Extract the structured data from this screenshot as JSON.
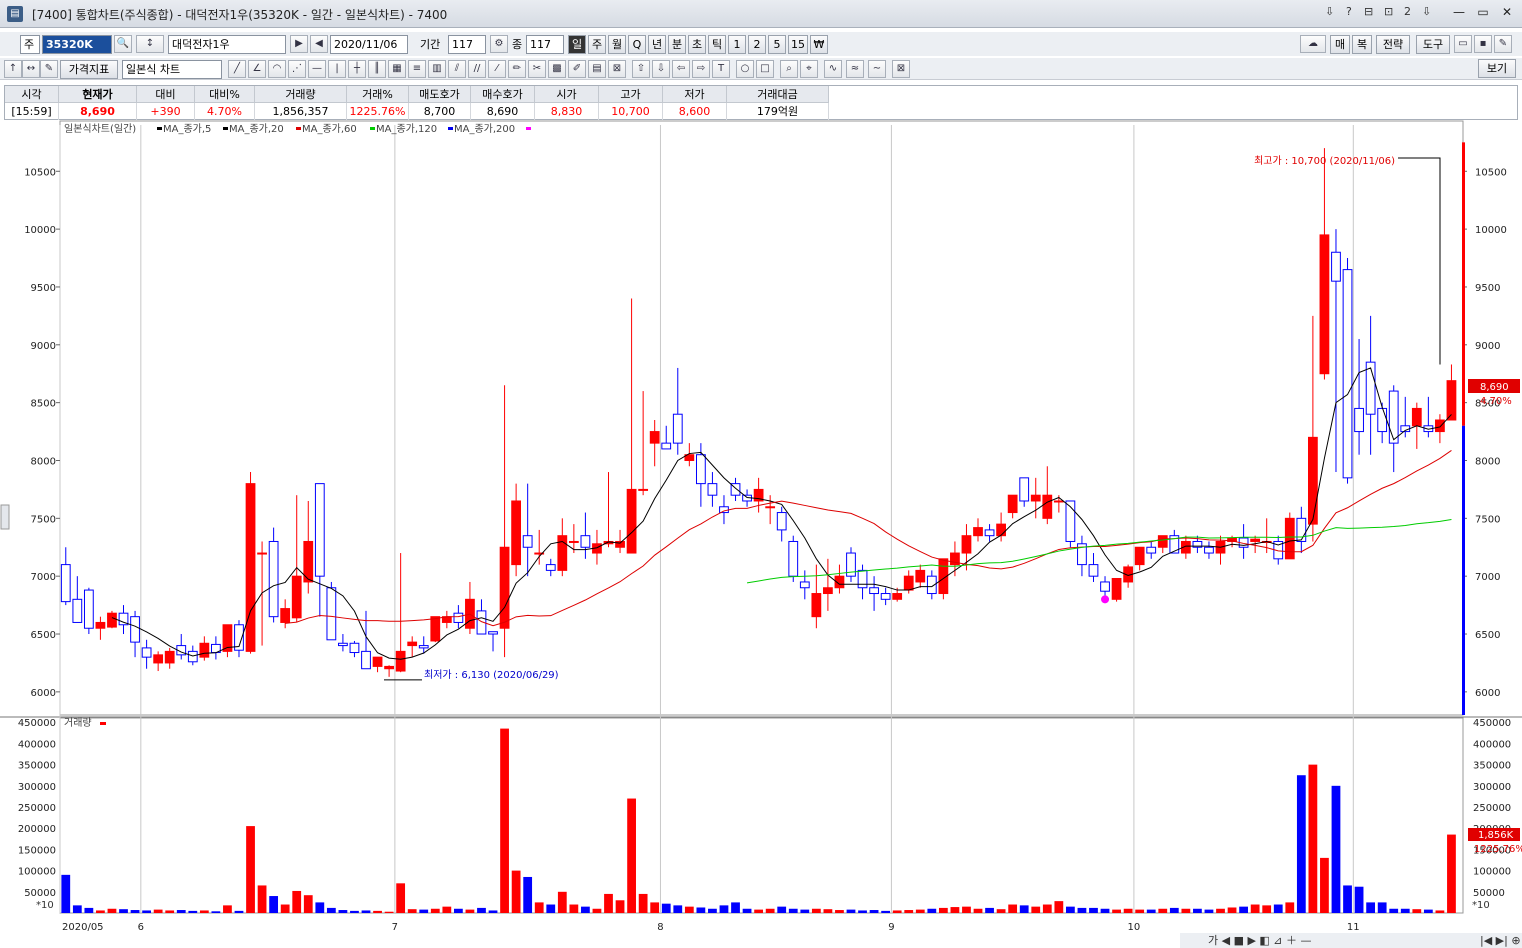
{
  "window": {
    "title": "[7400] 통합차트(주식종합) - 대덕전자1우(35320K - 일간 - 일본식차트) - 7400",
    "controls": [
      "⇩",
      "?",
      "⊟",
      "⊡",
      "2",
      "⇩",
      "—",
      "▭",
      "✕"
    ]
  },
  "toolbar1": {
    "type_label": "주",
    "code": "35320K",
    "stock_name": "대덕전자1우",
    "date": "2020/11/06",
    "period_label": "기간",
    "period_value": "117",
    "count_label": "종",
    "count_value": "117",
    "intervals": [
      "일",
      "주",
      "월",
      "Q",
      "년",
      "분",
      "초",
      "틱",
      "1",
      "2",
      "5",
      "15",
      "₩"
    ],
    "right_buttons": [
      "매",
      "복",
      "전략",
      "도구"
    ]
  },
  "toolbar2": {
    "indicator_btn": "가격지표",
    "chart_type": "일본식 차트",
    "view_btn": "보기"
  },
  "quote": {
    "headers": [
      "시각",
      "현재가",
      "대비",
      "대비%",
      "거래량",
      "거래%",
      "매도호가",
      "매수호가",
      "시가",
      "고가",
      "저가",
      "거래대금"
    ],
    "values": [
      "[15:59]",
      "8,690",
      "+390",
      "4.70%",
      "1,856,357",
      "1225.76%",
      "8,700",
      "8,690",
      "8,830",
      "10,700",
      "8,600",
      "179억원"
    ]
  },
  "colors": {
    "up": "#ff0000",
    "down": "#0000ff",
    "ma5": "#000000",
    "ma20": "#dd0000",
    "ma60": "#00cc00",
    "ma120": "#0000ee",
    "ma200": "#ff00ff"
  },
  "chart_data": {
    "type": "candlestick",
    "legend": {
      "title": "일본식차트(일간)",
      "items": [
        "MA_종가,5",
        "MA_종가,20",
        "MA_종가,60",
        "MA_종가,120",
        "MA_종가,200"
      ]
    },
    "volume_title": "거래량",
    "volume_unit": "*10",
    "price_ylim": [
      5800,
      10900
    ],
    "price_ticks": [
      6000,
      6500,
      7000,
      7500,
      8000,
      8500,
      9000,
      9500,
      10000,
      10500
    ],
    "volume_ylim": [
      0,
      460000
    ],
    "volume_ticks": [
      50000,
      100000,
      150000,
      200000,
      250000,
      300000,
      350000,
      400000,
      450000
    ],
    "x_labels": [
      {
        "i": 0,
        "t": "2020/05"
      },
      {
        "i": 7,
        "t": "6"
      },
      {
        "i": 29,
        "t": "7"
      },
      {
        "i": 52,
        "t": "8"
      },
      {
        "i": 72,
        "t": "9"
      },
      {
        "i": 93,
        "t": "10"
      },
      {
        "i": 112,
        "t": "11"
      }
    ],
    "annotations": {
      "high": {
        "text": "최고가 : 10,700 (2020/11/06)",
        "i": 108,
        "v": 10700
      },
      "low": {
        "text": "최저가 : 6,130 (2020/06/29)",
        "i": 28,
        "v": 6130
      }
    },
    "last_price": {
      "price": "8,690",
      "pct": "4.70%",
      "vol": "1,856K",
      "volpct": "1225.76%"
    },
    "candles": [
      [
        7100,
        7250,
        6750,
        6780,
        90000
      ],
      [
        6800,
        7000,
        6600,
        6600,
        18000
      ],
      [
        6880,
        6900,
        6500,
        6550,
        12000
      ],
      [
        6550,
        6650,
        6450,
        6600,
        6000
      ],
      [
        6560,
        6700,
        6550,
        6680,
        10000
      ],
      [
        6680,
        6750,
        6500,
        6580,
        9000
      ],
      [
        6650,
        6700,
        6300,
        6430,
        7000
      ],
      [
        6380,
        6450,
        6200,
        6300,
        6000
      ],
      [
        6250,
        6350,
        6180,
        6320,
        8000
      ],
      [
        6250,
        6380,
        6200,
        6350,
        6000
      ],
      [
        6400,
        6500,
        6280,
        6320,
        7000
      ],
      [
        6350,
        6400,
        6230,
        6260,
        5000
      ],
      [
        6300,
        6480,
        6270,
        6420,
        6000
      ],
      [
        6410,
        6480,
        6280,
        6340,
        4000
      ],
      [
        6350,
        6550,
        6300,
        6580,
        18000
      ],
      [
        6580,
        6620,
        6300,
        6360,
        5000
      ],
      [
        6350,
        7900,
        6330,
        7800,
        205000
      ],
      [
        7200,
        7300,
        6400,
        7200,
        65000
      ],
      [
        7300,
        7420,
        6600,
        6650,
        40000
      ],
      [
        6600,
        6800,
        6550,
        6720,
        20000
      ],
      [
        6640,
        7700,
        6600,
        7000,
        52000
      ],
      [
        6950,
        7650,
        6850,
        7300,
        42000
      ],
      [
        7800,
        7800,
        6650,
        7000,
        25000
      ],
      [
        6900,
        6950,
        6450,
        6450,
        12000
      ],
      [
        6420,
        6500,
        6350,
        6400,
        7000
      ],
      [
        6420,
        6440,
        6300,
        6340,
        5000
      ],
      [
        6350,
        6700,
        6200,
        6200,
        6000
      ],
      [
        6220,
        6300,
        6170,
        6300,
        5000
      ],
      [
        6200,
        6230,
        6130,
        6220,
        3000
      ],
      [
        6180,
        7200,
        6170,
        6350,
        70000
      ],
      [
        6400,
        6480,
        6300,
        6430,
        9000
      ],
      [
        6400,
        6480,
        6330,
        6380,
        8000
      ],
      [
        6440,
        6650,
        6430,
        6650,
        10000
      ],
      [
        6600,
        6700,
        6550,
        6650,
        15000
      ],
      [
        6680,
        6750,
        6550,
        6600,
        10000
      ],
      [
        6550,
        6950,
        6500,
        6800,
        8000
      ],
      [
        6700,
        6800,
        6500,
        6500,
        12000
      ],
      [
        6520,
        6520,
        6350,
        6500,
        6000
      ],
      [
        6550,
        8650,
        6300,
        7250,
        435000
      ],
      [
        7100,
        7800,
        7000,
        7650,
        100000
      ],
      [
        7350,
        7800,
        7000,
        7250,
        85000
      ],
      [
        7200,
        7400,
        7100,
        7200,
        25000
      ],
      [
        7100,
        7150,
        7000,
        7050,
        20000
      ],
      [
        7050,
        7500,
        7000,
        7350,
        50000
      ],
      [
        7300,
        7450,
        7200,
        7300,
        20000
      ],
      [
        7350,
        7550,
        7150,
        7250,
        15000
      ],
      [
        7200,
        7400,
        7100,
        7280,
        10000
      ],
      [
        7280,
        7900,
        7250,
        7300,
        45000
      ],
      [
        7250,
        7400,
        7200,
        7300,
        30000
      ],
      [
        7200,
        9400,
        7200,
        7750,
        270000
      ],
      [
        7750,
        8600,
        7700,
        7750,
        45000
      ],
      [
        8150,
        8350,
        7950,
        8250,
        25000
      ],
      [
        8150,
        8300,
        8100,
        8100,
        22000
      ],
      [
        8400,
        8800,
        8050,
        8150,
        18000
      ],
      [
        8000,
        8150,
        7950,
        8050,
        15000
      ],
      [
        8050,
        8150,
        7600,
        7800,
        13000
      ],
      [
        7800,
        7900,
        7600,
        7700,
        10000
      ],
      [
        7600,
        7700,
        7450,
        7550,
        18000
      ],
      [
        7800,
        7850,
        7650,
        7700,
        25000
      ],
      [
        7700,
        7750,
        7600,
        7650,
        10000
      ],
      [
        7650,
        7850,
        7550,
        7750,
        8000
      ],
      [
        7600,
        7700,
        7450,
        7600,
        10000
      ],
      [
        7550,
        7600,
        7300,
        7400,
        15000
      ],
      [
        7300,
        7350,
        6950,
        7000,
        10000
      ],
      [
        6950,
        7050,
        6800,
        6900,
        8000
      ],
      [
        6650,
        7100,
        6550,
        6850,
        10000
      ],
      [
        6850,
        7150,
        6700,
        6900,
        9000
      ],
      [
        6900,
        7100,
        6850,
        7000,
        7000
      ],
      [
        7200,
        7250,
        6950,
        7000,
        8000
      ],
      [
        7050,
        7100,
        6800,
        6900,
        6000
      ],
      [
        6900,
        7000,
        6700,
        6850,
        7000
      ],
      [
        6850,
        6900,
        6750,
        6800,
        5000
      ],
      [
        6800,
        6900,
        6780,
        6850,
        6000
      ],
      [
        6880,
        7050,
        6850,
        7000,
        7000
      ],
      [
        6950,
        7100,
        6900,
        7050,
        8000
      ],
      [
        7000,
        7050,
        6800,
        6850,
        10000
      ],
      [
        6850,
        7150,
        6800,
        7150,
        12000
      ],
      [
        7100,
        7300,
        7000,
        7200,
        14000
      ],
      [
        7200,
        7450,
        7050,
        7350,
        15000
      ],
      [
        7350,
        7500,
        7300,
        7420,
        10000
      ],
      [
        7400,
        7450,
        7300,
        7350,
        12000
      ],
      [
        7350,
        7550,
        7300,
        7450,
        9000
      ],
      [
        7550,
        7700,
        7500,
        7700,
        20000
      ],
      [
        7850,
        7850,
        7600,
        7650,
        18000
      ],
      [
        7650,
        7850,
        7500,
        7700,
        15000
      ],
      [
        7500,
        7950,
        7450,
        7700,
        20000
      ],
      [
        7650,
        7700,
        7550,
        7650,
        28000
      ],
      [
        7650,
        7650,
        7250,
        7300,
        15000
      ],
      [
        7280,
        7350,
        7000,
        7100,
        12000
      ],
      [
        7100,
        7200,
        6950,
        7000,
        12000
      ],
      [
        6950,
        7000,
        6800,
        6870,
        10000
      ],
      [
        6800,
        6980,
        6780,
        6980,
        8000
      ],
      [
        6950,
        7100,
        6900,
        7080,
        10000
      ],
      [
        7100,
        7250,
        7050,
        7250,
        8000
      ],
      [
        7250,
        7300,
        7150,
        7200,
        8000
      ],
      [
        7250,
        7350,
        7200,
        7350,
        10000
      ],
      [
        7350,
        7400,
        7200,
        7200,
        12000
      ],
      [
        7200,
        7350,
        7150,
        7300,
        10000
      ],
      [
        7300,
        7350,
        7200,
        7250,
        10000
      ],
      [
        7250,
        7300,
        7150,
        7200,
        8000
      ],
      [
        7200,
        7350,
        7100,
        7300,
        10000
      ],
      [
        7300,
        7350,
        7250,
        7330,
        13000
      ],
      [
        7330,
        7450,
        7150,
        7250,
        15000
      ],
      [
        7300,
        7350,
        7200,
        7320,
        20000
      ],
      [
        7300,
        7500,
        7200,
        7300,
        18000
      ],
      [
        7300,
        7350,
        7100,
        7150,
        20000
      ],
      [
        7150,
        7550,
        7150,
        7500,
        25000
      ],
      [
        7500,
        7600,
        7200,
        7300,
        325000
      ],
      [
        7450,
        9250,
        7300,
        8200,
        350000
      ],
      [
        8750,
        10700,
        8700,
        9950,
        130000
      ],
      [
        9800,
        10000,
        7900,
        9550,
        300000
      ],
      [
        9650,
        9750,
        7800,
        7850,
        65000
      ],
      [
        8450,
        9050,
        8050,
        8250,
        62000
      ],
      [
        8850,
        9250,
        8050,
        8400,
        25000
      ],
      [
        8450,
        8500,
        8150,
        8250,
        25000
      ],
      [
        8600,
        8650,
        7900,
        8150,
        10000
      ],
      [
        8300,
        8550,
        8200,
        8250,
        10000
      ],
      [
        8300,
        8500,
        8100,
        8450,
        9000
      ],
      [
        8300,
        8550,
        8200,
        8250,
        8000
      ],
      [
        8250,
        8400,
        8150,
        8350,
        6000
      ],
      [
        8350,
        8830,
        8600,
        8690,
        185000
      ]
    ]
  }
}
